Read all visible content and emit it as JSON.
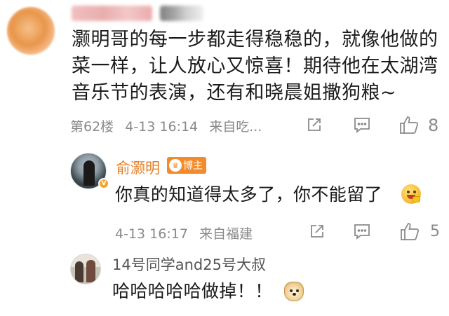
{
  "colors": {
    "author_name": "#e5812b",
    "host_badge": "#f48b2b",
    "meta_gray": "#8a8a8a",
    "text": "#1b1b1b"
  },
  "comment": {
    "avatar": "blurred-avatar",
    "name": "",
    "badge": "",
    "text": "灏明哥的每一步都走得稳稳的，就像他做的菜一样，让人放心又惊喜！期待他在太湖湾音乐节的表演，还有和晓晨姐撒狗粮~",
    "floor": "第62楼",
    "time": "4-13 16:14",
    "source": "来自吃...",
    "like_count": "8"
  },
  "replies": [
    {
      "name": "俞灏明",
      "badge_label": "博主",
      "verified_icon": "v-badge-icon",
      "text": "你真的知道得太多了，你不能留了",
      "emoji": "smile-hand-emoji",
      "time": "4-13 16:17",
      "source": "来自福建",
      "like_count": "5"
    },
    {
      "name": "14号同学and25号大叔",
      "text": "哈哈哈哈哈做掉！！",
      "emoji": "doge-emoji"
    }
  ]
}
